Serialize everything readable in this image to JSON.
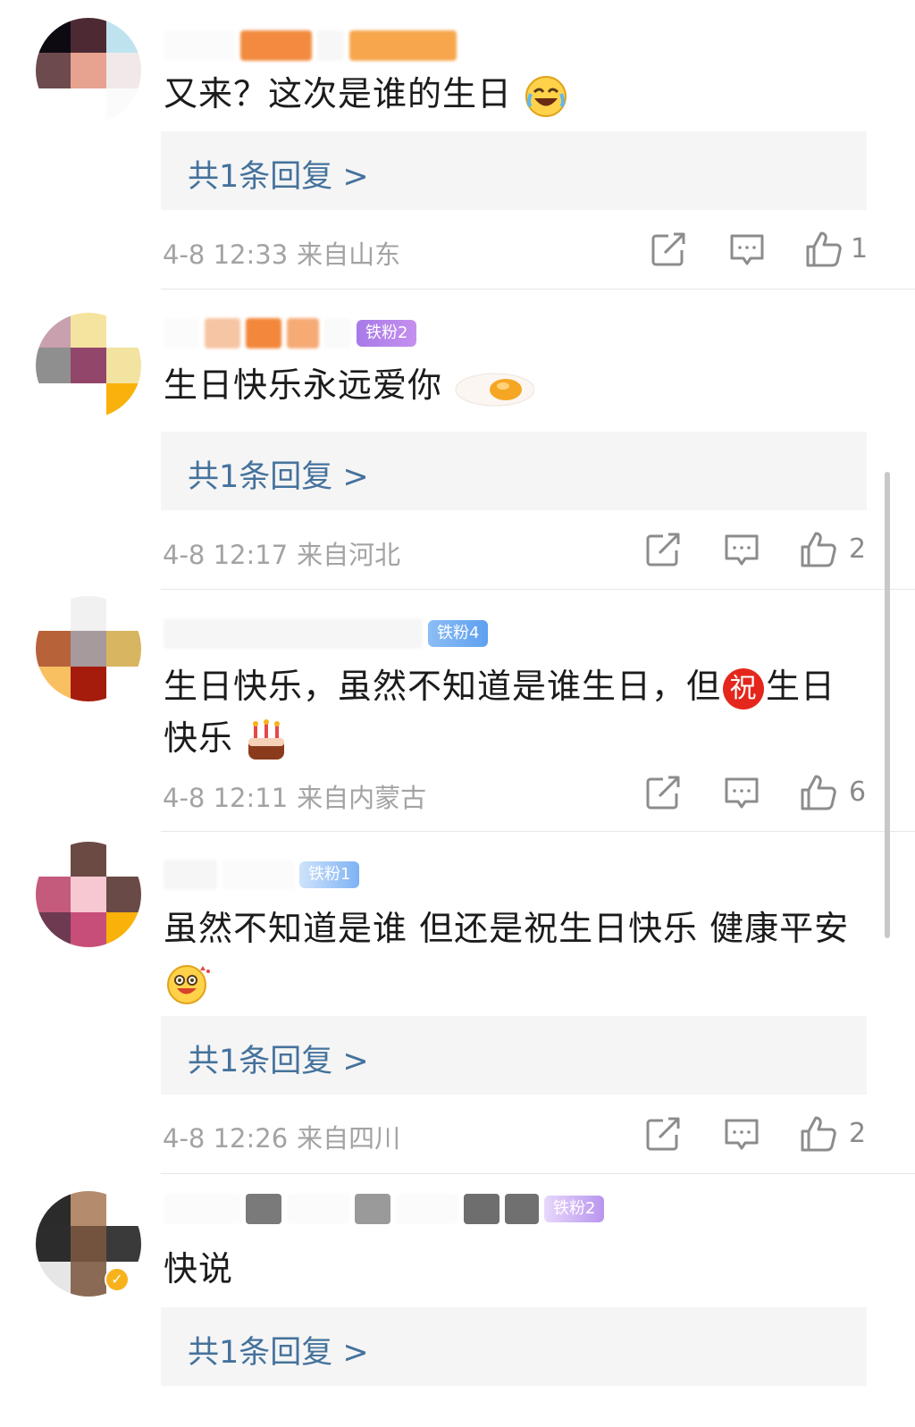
{
  "comments": [
    {
      "text": "又来？这次是谁的生日",
      "emoji": "laugh-cry-emoji",
      "reply_label": "共1条回复 >",
      "time": "4-8 12:33",
      "location": "来自山东",
      "likes": "1"
    },
    {
      "text": "生日快乐永远爱你",
      "emoji": "fried-egg-emoji",
      "fan_badge": "铁粉2",
      "reply_label": "共1条回复 >",
      "time": "4-8 12:17",
      "location": "来自河北",
      "likes": "2"
    },
    {
      "text_line1_a": "生日快乐，虽然不知道是谁生日，但",
      "text_line1_b": "生日",
      "text_line2": "快乐",
      "badge_char": "祝",
      "emoji": "birthday-cake-emoji",
      "fan_badge": "铁粉4",
      "time": "4-8 12:11",
      "location": "来自内蒙古",
      "likes": "6"
    },
    {
      "text": "虽然不知道是谁 但还是祝生日快乐 健康平安",
      "emoji": "happy-face-emoji",
      "fan_badge": "铁粉1",
      "reply_label": "共1条回复 >",
      "time": "4-8 12:26",
      "location": "来自四川",
      "likes": "2"
    },
    {
      "text": "快说",
      "fan_badge": "铁粉2",
      "reply_label": "共1条回复 >"
    }
  ],
  "icons": {
    "share": "share-icon",
    "comment": "comment-icon",
    "like": "thumbs-up-icon",
    "verified": "verified-badge-icon"
  },
  "colors": {
    "reply_link": "#45729c",
    "reply_bg": "#f5f5f5",
    "meta_text": "#a3a3a3",
    "divider": "#e7e7e7",
    "verified": "#f7b21c"
  }
}
